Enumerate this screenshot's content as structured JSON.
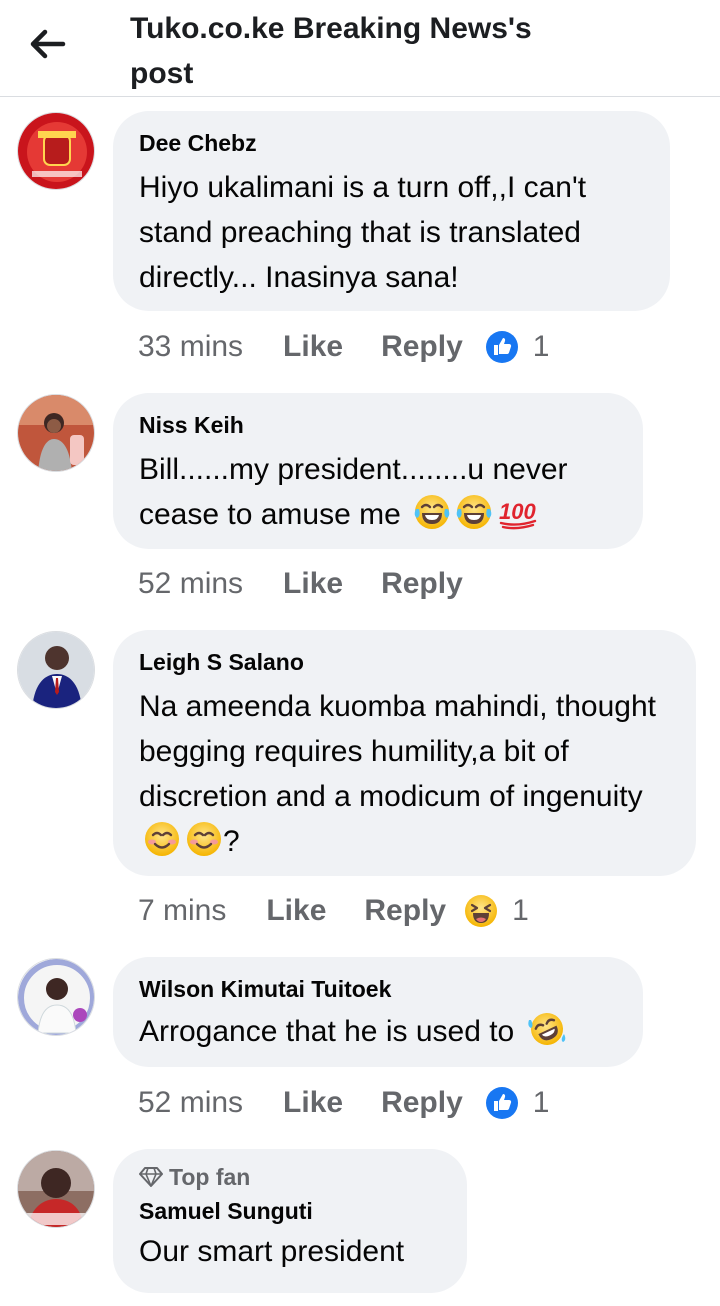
{
  "header": {
    "title": "Tuko.co.ke Breaking News's post",
    "back_icon": "arrow-left-icon"
  },
  "comments": [
    {
      "author": "Dee Chebz",
      "text": "Hiyo ukalimani is a turn off,,I can't stand preaching that is translated directly... Inasinya sana!",
      "time": "33 mins",
      "like_label": "Like",
      "reply_label": "Reply",
      "reaction": "like-icon",
      "reaction_count": "1"
    },
    {
      "author": "Niss Keih",
      "text": "Bill......my president........u never cease to amuse me",
      "emojis": [
        "laughing-tears-emoji",
        "laughing-tears-emoji",
        "hundred-points-emoji"
      ],
      "time": "52 mins",
      "like_label": "Like",
      "reply_label": "Reply"
    },
    {
      "author": "Leigh S Salano",
      "text": "Na ameenda kuomba mahindi, thought begging requires humility,a bit of discretion and a modicum of ingenuity",
      "emojis": [
        "smiling-emoji",
        "smiling-emoji"
      ],
      "text_suffix": "?",
      "time": "7 mins",
      "like_label": "Like",
      "reply_label": "Reply",
      "reaction": "haha-icon",
      "reaction_count": "1"
    },
    {
      "author": "Wilson Kimutai Tuitoek",
      "text": "Arrogance that he is used to",
      "emojis": [
        "rolling-laughing-emoji"
      ],
      "time": "52 mins",
      "like_label": "Like",
      "reply_label": "Reply",
      "reaction": "like-icon",
      "reaction_count": "1"
    },
    {
      "badge": "Top fan",
      "author": "Samuel Sunguti",
      "text": "Our smart president"
    }
  ],
  "colors": {
    "bubble": "#f0f2f5",
    "meta_text": "#65676b",
    "like_blue": "#1877f2",
    "emoji_yellow": "#fbc02d"
  }
}
